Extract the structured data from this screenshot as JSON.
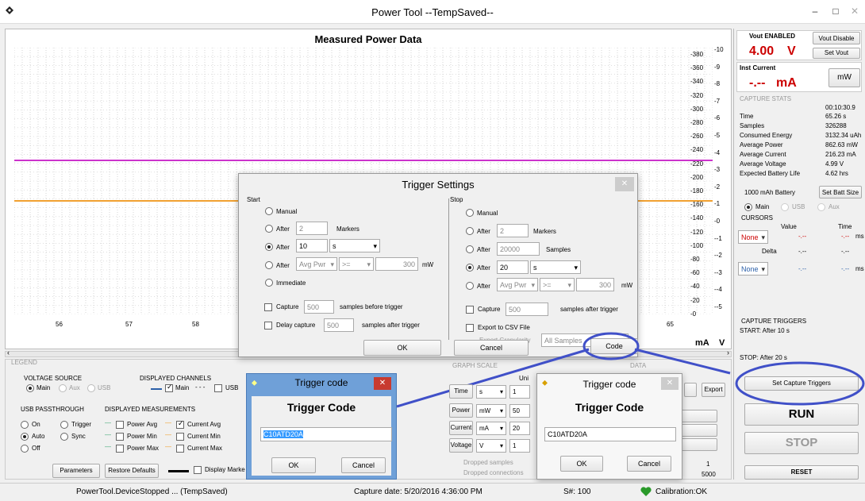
{
  "window": {
    "title": "Power Tool --TempSaved--",
    "minimize": "–",
    "maximize": "□",
    "close": "✕"
  },
  "chart": {
    "title": "Measured Power Data",
    "x_ticks": [
      "56",
      "57",
      "58",
      "65"
    ],
    "left_axis": [
      "380",
      "360",
      "340",
      "320",
      "300",
      "280",
      "260",
      "240",
      "220",
      "200",
      "180",
      "160",
      "140",
      "120",
      "100",
      "80",
      "60",
      "40",
      "20",
      "0"
    ],
    "right_axis": [
      "10",
      "9",
      "8",
      "7",
      "6",
      "5",
      "4",
      "3",
      "2",
      "1",
      "0",
      "-1",
      "-2",
      "-3",
      "-4",
      "-5"
    ],
    "unit_left": "mA",
    "unit_right": "V",
    "colors": {
      "magenta_line": "#cc33cc",
      "orange_line": "#f0a030"
    }
  },
  "right": {
    "vout_enabled": "Vout ENABLED",
    "vout_disable": "Vout Disable",
    "vout_value": "4.00",
    "vout_unit": "V",
    "set_vout": "Set Vout",
    "inst_current": "Inst Current",
    "inst_value": "-.--",
    "inst_unit": "mA",
    "mw_button": "mW",
    "capture_stats": "CAPTURE STATS",
    "time_top": "00:10:30.9",
    "stats": [
      {
        "label": "Time",
        "value": "65.26 s"
      },
      {
        "label": "Samples",
        "value": "326288"
      },
      {
        "label": "Consumed Energy",
        "value": "3132.34  uAh"
      },
      {
        "label": "Average Power",
        "value": "862.63  mW"
      },
      {
        "label": "Average Current",
        "value": "216.23  mA"
      },
      {
        "label": "Average Voltage",
        "value": "4.99  V"
      },
      {
        "label": "Expected Battery Life",
        "value": "4.62  hrs"
      }
    ],
    "battery": "1000  mAh Battery",
    "set_batt": "Set Batt Size",
    "main": "Main",
    "usb": "USB",
    "aux": "Aux",
    "cursors": "CURSORS",
    "value": "Value",
    "time": "Time",
    "none": "None",
    "delta": "Delta",
    "dash": "-.--",
    "ms": "ms",
    "cap_triggers": "CAPTURE TRIGGERS",
    "start": "START:   After 10 s",
    "stop": "STOP:   After 20 s",
    "set_capture": "Set Capture Triggers",
    "run": "RUN",
    "stop_btn": "STOP",
    "reset": "RESET"
  },
  "trigger": {
    "title": "Trigger Settings",
    "close": "✕",
    "start": "Start",
    "stop": "Stop",
    "manual": "Manual",
    "after": "After",
    "markers": "Markers",
    "samples": "Samples",
    "immediate": "Immediate",
    "start_after_markers": "2",
    "start_after_time": "10",
    "time_unit": "s",
    "avg_pwr": "Avg Pwr",
    "gte": ">=",
    "pwr_val": "300",
    "mw": "mW",
    "capture": "Capture",
    "cap_val": "500",
    "samples_before": "samples before trigger",
    "delay_capture": "Delay capture",
    "delay_val": "500",
    "samples_after": "samples after trigger",
    "stop_after_markers": "2",
    "stop_after_samples": "20000",
    "stop_after_time": "20",
    "samples_after_trigger": "samples after trigger",
    "export_csv": "Export to CSV File",
    "export_gran": "Export Granularity",
    "all_samples": "All Samples",
    "ok": "OK",
    "cancel": "Cancel",
    "code": "Code"
  },
  "code1": {
    "title": "Trigger code",
    "heading": "Trigger Code",
    "value": "C10ATD20A",
    "ok": "OK",
    "cancel": "Cancel"
  },
  "code2": {
    "title": "Trigger code",
    "heading": "Trigger Code",
    "value": "C10ATD20A",
    "ok": "OK",
    "cancel": "Cancel"
  },
  "bottom": {
    "legend": "LEGEND",
    "voltage_source": "VOLTAGE SOURCE",
    "main": "Main",
    "aux": "Aux",
    "usb": "USB",
    "displayed_channels": "DISPLAYED CHANNELS",
    "usb_pass": "USB PASSTHROUGH",
    "on": "On",
    "auto": "Auto",
    "off": "Off",
    "trigger": "Trigger",
    "sync": "Sync",
    "displayed_meas": "DISPLAYED MEASUREMENTS",
    "power_avg": "Power Avg",
    "power_min": "Power Min",
    "power_max": "Power Max",
    "current_avg": "Current Avg",
    "current_min": "Current Min",
    "current_max": "Current Max",
    "parameters": "Parameters",
    "restore": "Restore Defaults",
    "display_markers": "Display Marke",
    "graph_scale": "GRAPH SCALE",
    "data": "DATA",
    "unit": "Uni",
    "rows": [
      {
        "name": "Time",
        "unit": "s",
        "val": "1"
      },
      {
        "name": "Power",
        "unit": "mW",
        "val": "50"
      },
      {
        "name": "Current",
        "unit": "mA",
        "val": "20"
      },
      {
        "name": "Voltage",
        "unit": "V",
        "val": "1"
      }
    ],
    "dropped_samples": "Dropped samples",
    "dropped_conn": "Dropped connections",
    "export": "Export",
    "sample_val": "1",
    "sample_val2": "5000"
  },
  "status": {
    "device": "PowerTool.DeviceStopped ... (TempSaved)",
    "capture_date": "Capture date: 5/20/2016 4:36:00 PM",
    "serial": "S#: 100",
    "calibration": "Calibration:OK"
  }
}
